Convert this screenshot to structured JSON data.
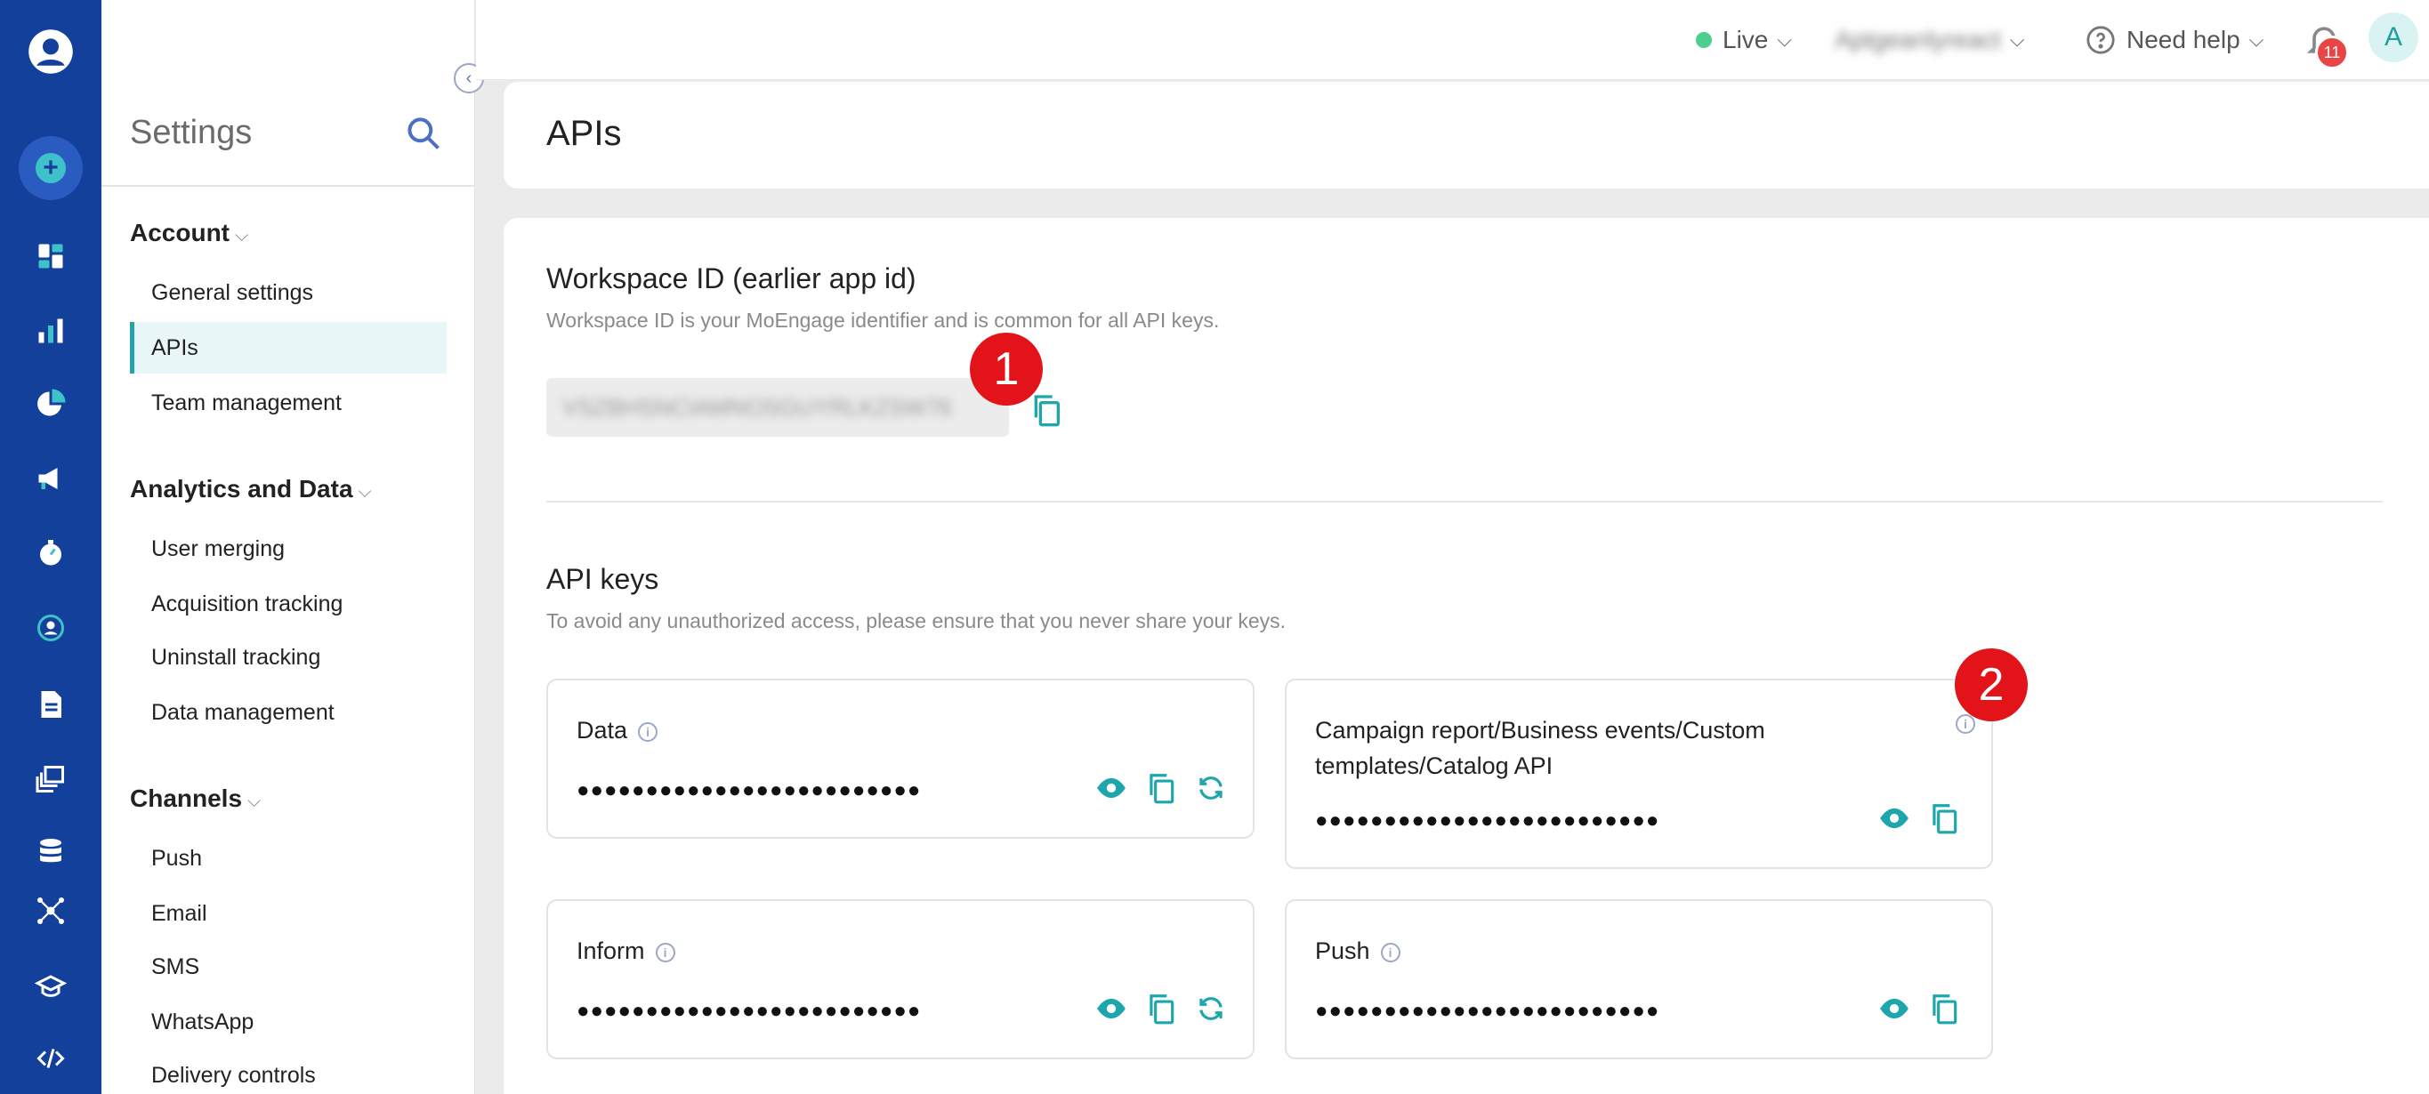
{
  "topbar": {
    "env_label": "Live",
    "workspace_name": "Aptgeanlyreact",
    "help_label": "Need help",
    "notification_count": "11",
    "avatar_initial": "A"
  },
  "sidebar": {
    "title": "Settings",
    "groups": [
      {
        "label": "Account",
        "items": [
          "General settings",
          "APIs",
          "Team management"
        ]
      },
      {
        "label": "Analytics and Data",
        "items": [
          "User merging",
          "Acquisition tracking",
          "Uninstall tracking",
          "Data management"
        ]
      },
      {
        "label": "Channels",
        "items": [
          "Push",
          "Email",
          "SMS",
          "WhatsApp",
          "Delivery controls"
        ]
      }
    ],
    "active_item": "APIs"
  },
  "page": {
    "title": "APIs",
    "workspace": {
      "heading": "Workspace ID (earlier app id)",
      "description": "Workspace ID is your MoEngage identifier and is common for all API keys.",
      "value": "VSZBHSNCIAMNOSGUYRLKZSW76"
    },
    "api_keys": {
      "heading": "API keys",
      "description": "To avoid any unauthorized access, please ensure that you never share your keys.",
      "cards": [
        {
          "title": "Data",
          "masked": "●●●●●●●●●●●●●●●●●●●●●●●●●"
        },
        {
          "title": "Campaign report/Business events/Custom templates/Catalog API",
          "masked": "●●●●●●●●●●●●●●●●●●●●●●●●●"
        },
        {
          "title": "Inform",
          "masked": "●●●●●●●●●●●●●●●●●●●●●●●●●"
        },
        {
          "title": "Push",
          "masked": "●●●●●●●●●●●●●●●●●●●●●●●●●"
        }
      ]
    }
  },
  "annotations": {
    "marker_1": "1",
    "marker_2": "2"
  },
  "colors": {
    "rail": "#13409a",
    "accent": "#1da6ab",
    "marker": "#e3131a"
  }
}
